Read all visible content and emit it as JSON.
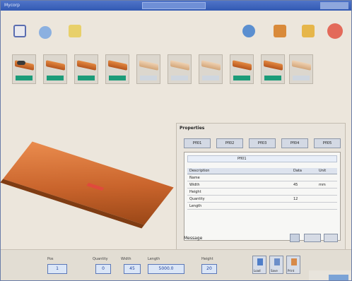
{
  "window": {
    "app_title": "Mycorp",
    "title_box": "",
    "colors": {
      "titlebar": "#3f66c0",
      "accent_green": "#1c9c79",
      "wood": "#c9642c"
    }
  },
  "toolbar": {
    "left": [
      {
        "icon": "new-document-icon"
      },
      {
        "icon": "open-icon"
      },
      {
        "icon": "wizard-icon"
      }
    ],
    "right": [
      {
        "icon": "refresh-icon"
      },
      {
        "icon": "layers-icon"
      },
      {
        "icon": "folder-icon"
      },
      {
        "icon": "close-icon"
      }
    ]
  },
  "thumbnails": [
    {
      "style": "dark",
      "tag": "on"
    },
    {
      "style": "wood",
      "tag": "on"
    },
    {
      "style": "wood",
      "tag": "on"
    },
    {
      "style": "wood",
      "tag": "on"
    },
    {
      "style": "light",
      "tag": "off"
    },
    {
      "style": "light",
      "tag": "off"
    },
    {
      "style": "light",
      "tag": "off"
    },
    {
      "style": "wood",
      "tag": "on"
    },
    {
      "style": "wood",
      "tag": "on"
    },
    {
      "style": "light",
      "tag": "off"
    }
  ],
  "panel": {
    "title": "Properties",
    "tabs": [
      "Pfl01",
      "Pfl02",
      "Pfl03",
      "Pfl04",
      "Pfl05"
    ],
    "combo": "Pfl01",
    "headers": [
      "Description",
      "Data",
      "Unit"
    ],
    "rows": [
      [
        "Name",
        "",
        ""
      ],
      [
        "Width",
        "45",
        "mm"
      ],
      [
        "Height",
        "",
        ""
      ],
      [
        "Quantity",
        "12",
        ""
      ],
      [
        "Length",
        "",
        ""
      ]
    ],
    "footer_label": "Message"
  },
  "bottom": {
    "fields": [
      {
        "label": "Pos",
        "value": "1"
      },
      {
        "label": "Quantity",
        "value": "0"
      },
      {
        "label": "Width",
        "value": "45"
      },
      {
        "label": "Length",
        "value": "5000.0"
      },
      {
        "label": "Height",
        "value": "20"
      }
    ],
    "buttons": [
      {
        "label": "Load",
        "icon": "load-icon"
      },
      {
        "label": "Save",
        "icon": "save-icon"
      },
      {
        "label": "Print",
        "icon": "print-icon"
      }
    ]
  }
}
